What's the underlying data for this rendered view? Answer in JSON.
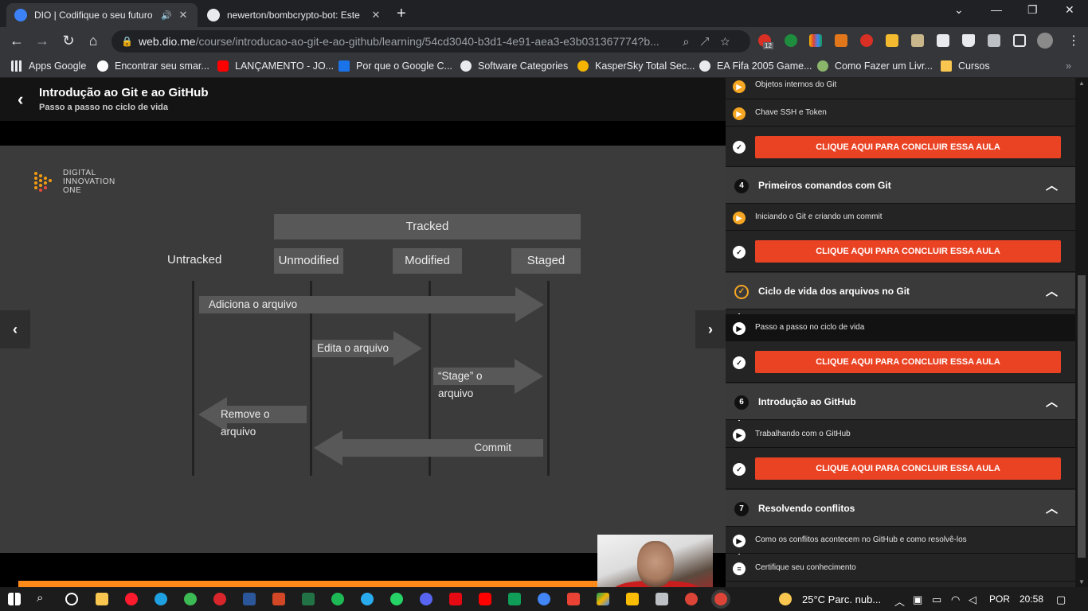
{
  "browser": {
    "tabs": [
      {
        "title": "DIO | Codifique o seu futuro",
        "active": true
      },
      {
        "title": "newerton/bombcrypto-bot: Este",
        "active": false
      }
    ],
    "url_host": "web.dio.me",
    "url_path": "/course/introducao-ao-git-e-ao-github/learning/54cd3040-b3d1-4e91-aea3-e3b031367774?b...",
    "bookmarks": [
      "Apps Google",
      "Encontrar seu smar...",
      "LANÇAMENTO - JO...",
      "Por que o Google C...",
      "Software Categories",
      "KasperSky Total Sec...",
      "EA Fifa 2005 Game...",
      "Como Fazer um Livr...",
      "Cursos"
    ],
    "notification_badge": "12"
  },
  "course": {
    "title": "Introdução ao Git e ao GitHub",
    "subtitle": "Passo a passo no ciclo de vida"
  },
  "slide": {
    "logo_lines": [
      "DIGITAL",
      "INNOVATION",
      "ONE"
    ],
    "tracked": "Tracked",
    "states": [
      "Untracked",
      "Unmodified",
      "Modified",
      "Staged"
    ],
    "arrows": {
      "adiciona": "Adiciona o arquivo",
      "edita": "Edita o arquivo",
      "stage": "“Stage” o arquivo",
      "remove": "Remove o arquivo",
      "commit": "Commit"
    }
  },
  "sidebar": {
    "lessons_top": [
      "Objetos internos do Git",
      "Chave SSH e Token"
    ],
    "conclude_label": "CLIQUE AQUI PARA CONCLUIR ESSA AULA",
    "modules": [
      {
        "num": "4",
        "title": "Primeiros comandos com Git",
        "lesson": "Iniciando o Git e criando um commit"
      },
      {
        "num": "",
        "title": "Ciclo de vida dos arquivos no Git",
        "lesson": "Passo a passo no ciclo de vida"
      },
      {
        "num": "6",
        "title": "Introdução ao GitHub",
        "lesson": "Trabalhando com o GitHub"
      },
      {
        "num": "7",
        "title": "Resolvendo conflitos",
        "lesson": "Como os conflitos acontecem no GitHub e como resolvê-los",
        "lesson2": "Certifique seu conhecimento"
      }
    ]
  },
  "taskbar": {
    "weather": "25°C  Parc. nub...",
    "lang": "POR",
    "time": "20:58"
  },
  "colors": {
    "accent_orange": "#ff8a1a",
    "button_red": "#ea4324",
    "play_orange": "#f5a623"
  }
}
